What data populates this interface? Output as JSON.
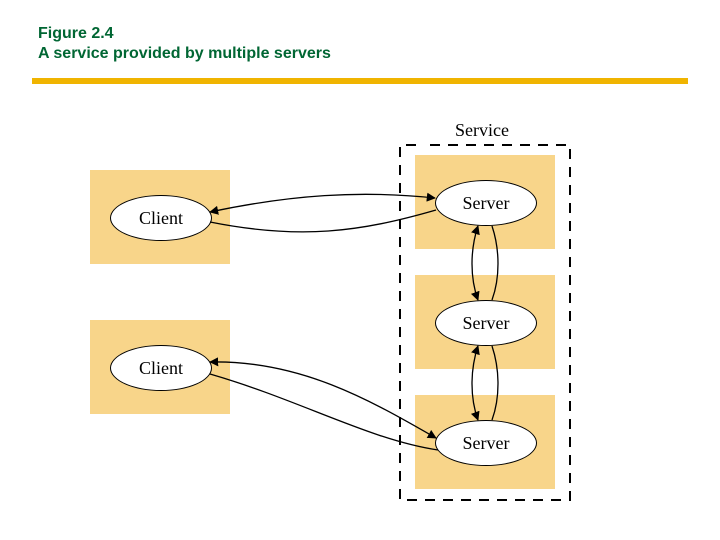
{
  "figure": {
    "number": "Figure 2.4",
    "caption": "A service provided by multiple servers"
  },
  "labels": {
    "service": "Service",
    "server": "Server",
    "client": "Client"
  },
  "nodes": {
    "client1": {
      "label_ref": "client"
    },
    "client2": {
      "label_ref": "client"
    },
    "server1": {
      "label_ref": "server"
    },
    "server2": {
      "label_ref": "server"
    },
    "server3": {
      "label_ref": "server"
    }
  },
  "edges": [
    {
      "from": "client1",
      "to": "server1",
      "bidirectional": true
    },
    {
      "from": "client2",
      "to": "server3",
      "bidirectional": true
    },
    {
      "from": "server1",
      "to": "server2",
      "bidirectional": true
    },
    {
      "from": "server2",
      "to": "server3",
      "bidirectional": true
    }
  ],
  "colors": {
    "title": "#006633",
    "rule": "#f0b400",
    "box": "#f8d58a",
    "background": "#ffffff"
  }
}
